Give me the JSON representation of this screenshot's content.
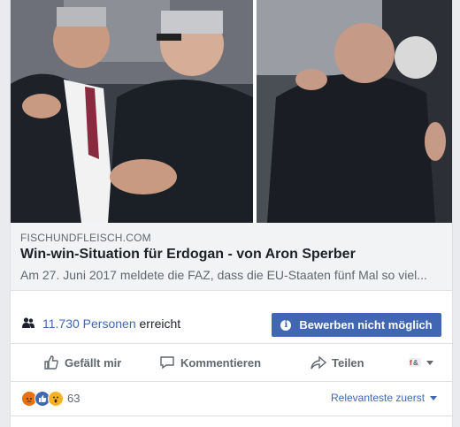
{
  "link_preview": {
    "domain": "FISCHUNDFLEISCH.COM",
    "title": "Win-win-Situation für Erdogan - von Aron Sperber",
    "description": "Am 27. Juni 2017 meldete die FAZ, dass die EU-Staaten fünf Mal so viel..."
  },
  "reach": {
    "count": "11.730",
    "people": "Personen",
    "suffix": "erreicht",
    "boost_label": "Bewerben nicht möglich",
    "boost_icon": "i"
  },
  "actions": {
    "like": "Gefällt mir",
    "comment": "Kommentieren",
    "share": "Teilen"
  },
  "reactions": {
    "icons": [
      "angry-reaction-icon",
      "like-reaction-icon",
      "wow-reaction-icon"
    ],
    "count": "63",
    "sort_label": "Relevanteste zuerst"
  },
  "colors": {
    "accent": "#4267b2",
    "text_secondary": "#606770",
    "card_border": "#dddfe2"
  }
}
